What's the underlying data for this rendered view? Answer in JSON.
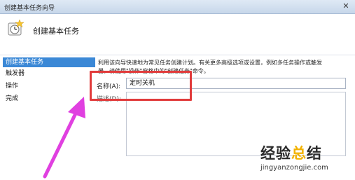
{
  "window": {
    "title": "创建基本任务向导"
  },
  "header": {
    "icon": "task-wizard-icon",
    "heading": "创建基本任务"
  },
  "nav": {
    "items": [
      {
        "label": "创建基本任务",
        "active": true
      },
      {
        "label": "触发器",
        "active": false
      },
      {
        "label": "操作",
        "active": false
      },
      {
        "label": "完成",
        "active": false
      }
    ]
  },
  "main": {
    "description_lines": [
      "利用该向导快速地为常见任务创建计划。有关更多高级选项或设置，例如多任务操作或触发",
      "器，请使用\"操作\"窗格中的\"创建任务\"命令。"
    ],
    "name_label": "名称(A):",
    "name_value": "定时关机",
    "desc_label": "描述(D):",
    "desc_value": ""
  },
  "annotations": {
    "highlight_color": "#e13b3b",
    "arrow_color": "#e040e0"
  },
  "watermark": {
    "text_a": "经验",
    "text_b": "总",
    "text_c": "结",
    "url": "jingyanzongjie.com"
  }
}
